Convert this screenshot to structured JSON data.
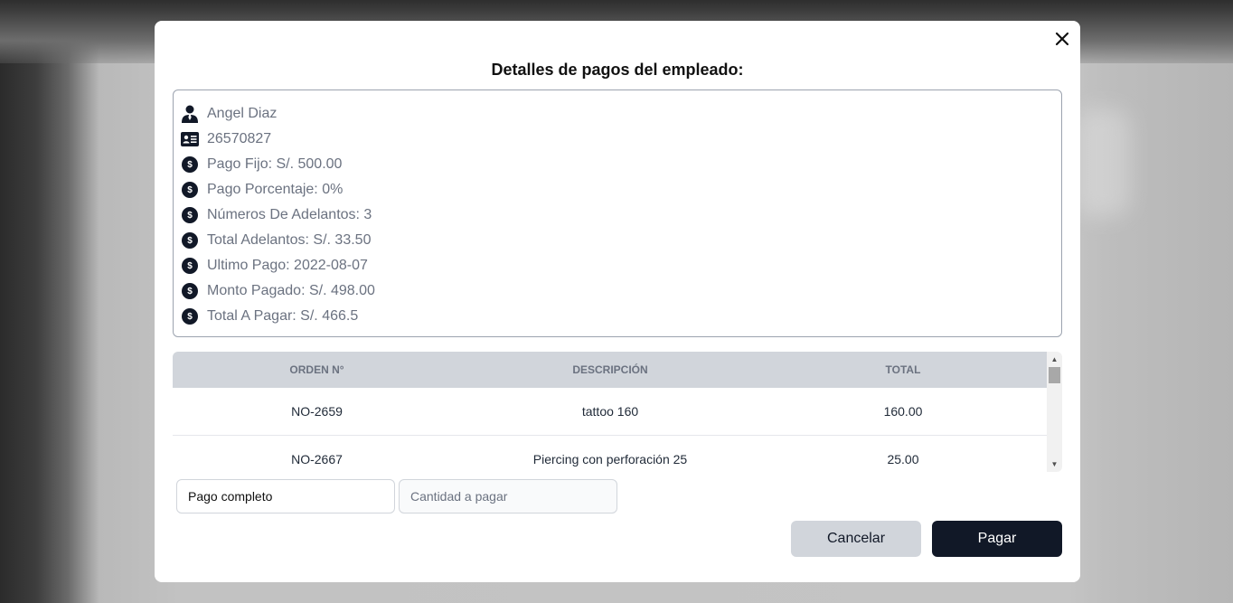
{
  "modal": {
    "title": "Detalles de pagos del empleado:",
    "close_icon": "close-icon"
  },
  "employee": {
    "name": "Angel Diaz",
    "document_id": "26570827",
    "fixed_pay": "Pago Fijo: S/. 500.00",
    "percentage_pay": "Pago Porcentaje: 0%",
    "advances_count": "Números De Adelantos: 3",
    "advances_total": "Total Adelantos: S/. 33.50",
    "last_payment": "Ultimo Pago: 2022-08-07",
    "amount_paid": "Monto Pagado: S/. 498.00",
    "total_to_pay": "Total A Pagar: S/. 466.5",
    "icons": [
      "user-tie-icon",
      "id-card-icon",
      "dollar-circle-icon"
    ]
  },
  "orders_table": {
    "headers": [
      "ORDEN N°",
      "DESCRIPCIÓN",
      "TOTAL"
    ],
    "rows": [
      [
        "NO-2659",
        "tattoo 160",
        "160.00"
      ],
      [
        "NO-2667",
        "Piercing con perforación 25",
        "25.00"
      ]
    ]
  },
  "payment_form": {
    "payment_type_selected": "Pago completo",
    "amount_placeholder": "Cantidad a pagar",
    "cancel_label": "Cancelar",
    "pay_label": "Pagar"
  },
  "colors": {
    "primary_dark": "#111827",
    "table_header_bg": "#d1d5db",
    "cancel_bg": "#d1d5db",
    "text_muted": "#6b7280"
  }
}
